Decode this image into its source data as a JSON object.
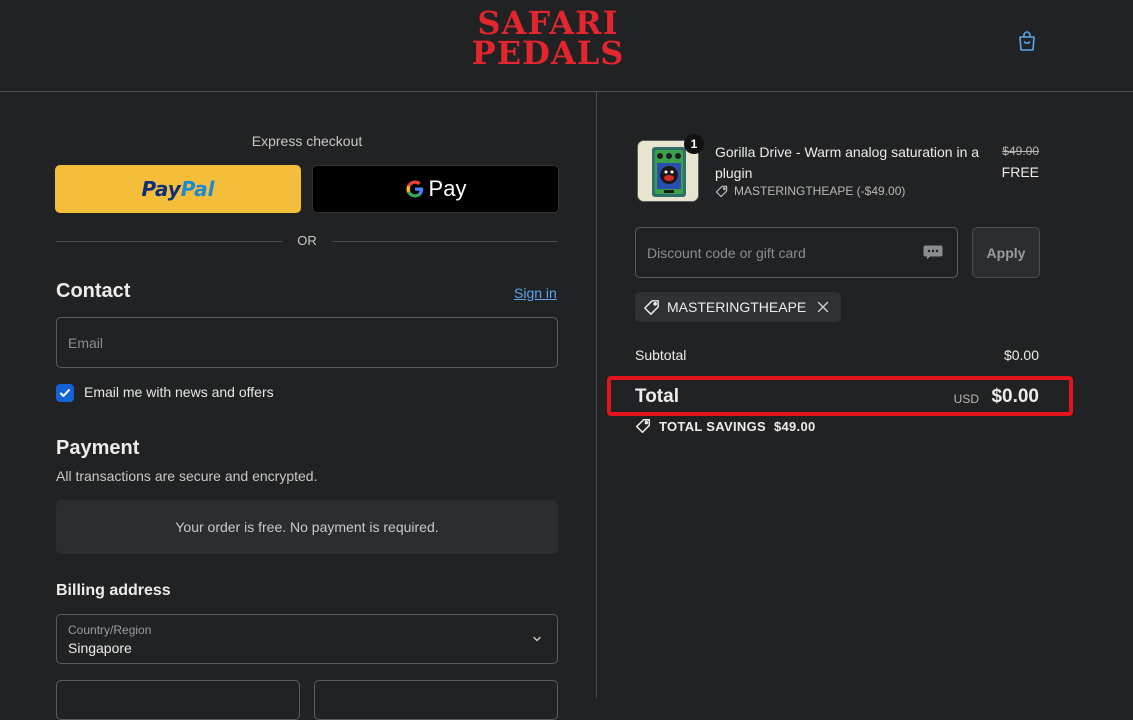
{
  "header": {
    "logo_line1": "SAFARI",
    "logo_line2": "PEDALS",
    "cart_icon": "shopping-bag-icon"
  },
  "checkout": {
    "express_title": "Express checkout",
    "paypal_label_1": "Pay",
    "paypal_label_2": "Pal",
    "gpay_label": "Pay",
    "or_label": "OR"
  },
  "contact": {
    "title": "Contact",
    "signin_label": "Sign in",
    "email_placeholder": "Email",
    "newsletter_label": "Email me with news and offers",
    "newsletter_checked": true
  },
  "payment": {
    "title": "Payment",
    "subtitle": "All transactions are secure and encrypted.",
    "free_notice": "Your order is free. No payment is required."
  },
  "billing": {
    "title": "Billing address",
    "country_label": "Country/Region",
    "country_value": "Singapore"
  },
  "summary": {
    "item": {
      "quantity": "1",
      "name": "Gorilla Drive - Warm analog saturation in a plugin",
      "discount_line": "MASTERINGTHEAPE (-$49.00)",
      "price_original": "$49.00",
      "price_final": "FREE"
    },
    "discount_placeholder": "Discount code or gift card",
    "apply_label": "Apply",
    "applied_code": "MASTERINGTHEAPE",
    "subtotal_label": "Subtotal",
    "subtotal_value": "$0.00",
    "total_label": "Total",
    "total_currency": "USD",
    "total_value": "$0.00",
    "savings_label": "TOTAL SAVINGS",
    "savings_value": "$49.00"
  },
  "colors": {
    "brand_red": "#e3262d",
    "paypal_yellow": "#f4be3a",
    "link_blue": "#5aa6f0",
    "highlight_red": "#e3141b"
  }
}
